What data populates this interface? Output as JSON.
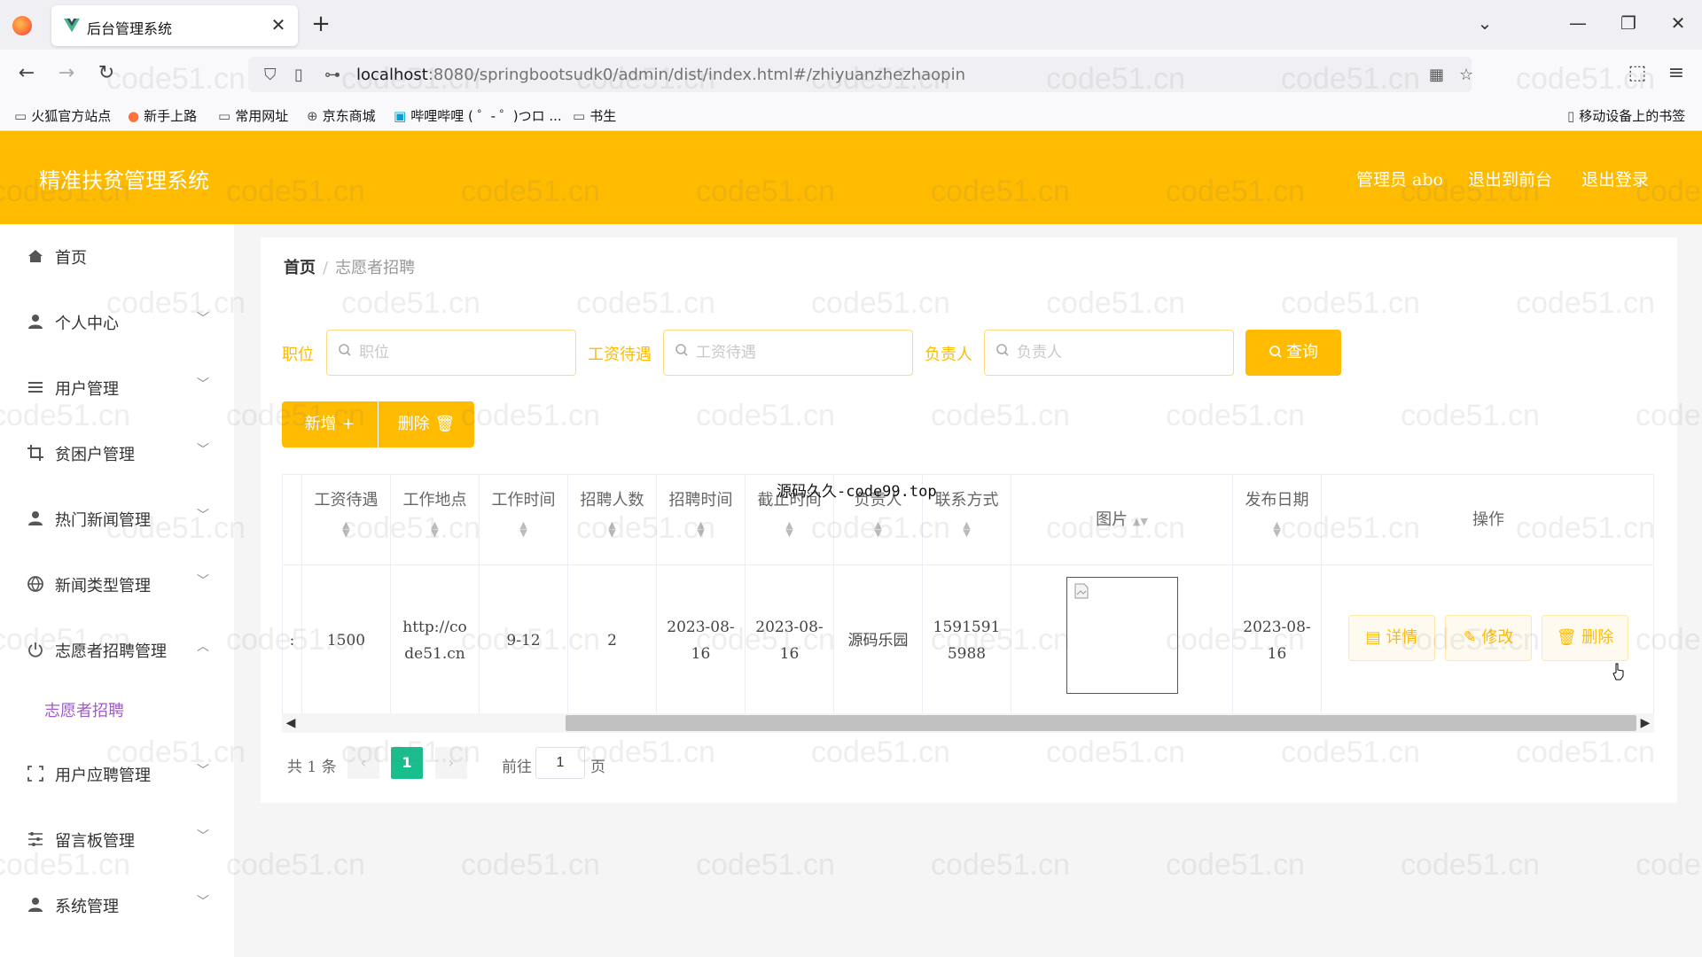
{
  "browser": {
    "tab_title": "后台管理系统",
    "url_host": "localhost",
    "url_rest": ":8080/springbootsudk0/admin/dist/index.html#/zhiyuanzhezhaopin",
    "bookmarks": [
      "火狐官方站点",
      "新手上路",
      "常用网址",
      "京东商城",
      "哔哩哔哩 ( ゜- ゜)つロ ...",
      "书生"
    ],
    "mobile_bookmarks": "移动设备上的书签"
  },
  "header": {
    "title": "精准扶贫管理系统",
    "admin_label": "管理员 abo",
    "front_link": "退出到前台",
    "logout_link": "退出登录"
  },
  "sidebar": {
    "items": [
      {
        "label": "首页",
        "icon": "home-icon"
      },
      {
        "label": "个人中心",
        "icon": "user-icon"
      },
      {
        "label": "用户管理",
        "icon": "list-icon"
      },
      {
        "label": "贫困户管理",
        "icon": "crop-icon"
      },
      {
        "label": "热门新闻管理",
        "icon": "user-icon"
      },
      {
        "label": "新闻类型管理",
        "icon": "globe-icon"
      },
      {
        "label": "志愿者招聘管理",
        "icon": "power-icon"
      },
      {
        "label": "用户应聘管理",
        "icon": "frame-icon"
      },
      {
        "label": "留言板管理",
        "icon": "sliders-icon"
      },
      {
        "label": "系统管理",
        "icon": "user-icon"
      }
    ],
    "active_sub": "志愿者招聘"
  },
  "breadcrumb": {
    "home": "首页",
    "current": "志愿者招聘"
  },
  "search": {
    "position_label": "职位",
    "position_placeholder": "职位",
    "salary_label": "工资待遇",
    "salary_placeholder": "工资待遇",
    "owner_label": "负责人",
    "owner_placeholder": "负责人",
    "query_button": "查询"
  },
  "actions": {
    "add": "新增 +",
    "delete": "删除"
  },
  "table": {
    "columns": [
      "工资待遇",
      "工作地点",
      "工作时间",
      "招聘人数",
      "招聘时间",
      "截止时间",
      "负责人",
      "联系方式",
      "图片",
      "发布日期",
      "操作"
    ],
    "row": [
      "1500",
      "http://code51.cn",
      "9-12",
      "2",
      "2023-08-16",
      "2023-08-16",
      "源码乐园",
      "15915915988",
      "",
      "2023-08-16"
    ],
    "row_actions": {
      "detail": "详情",
      "edit": "修改",
      "remove": "删除"
    }
  },
  "pagination": {
    "total": "共 1 条",
    "current": "1",
    "goto": "前往",
    "page_input": "1",
    "unit": "页"
  },
  "overlay": "源码久久-code99.top",
  "watermark": "code51.cn",
  "colors": {
    "accent": "#ffbb00",
    "page_active": "#19be8f",
    "submenu_active": "#a259c9"
  }
}
